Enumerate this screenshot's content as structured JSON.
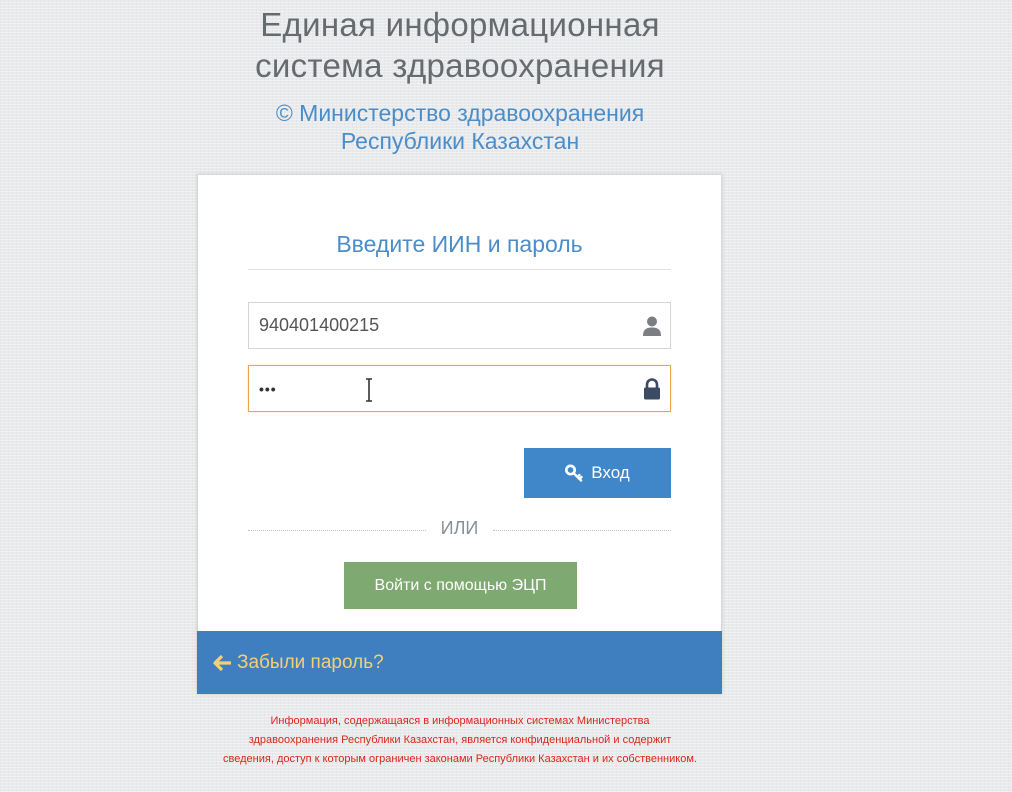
{
  "header": {
    "system_title_line1": "Единая информационная",
    "system_title_line2": "система здравоохранения",
    "ministry_line1": "© Министерство здравоохранения",
    "ministry_line2": "Республики Казахстан"
  },
  "login": {
    "heading": "Введите ИИН и пароль",
    "iin_value": "940401400215",
    "password_value": "•••",
    "login_button": "Вход",
    "or_text": "ИЛИ",
    "eds_button": "Войти с помощью ЭЦП",
    "forgot_password": "Забыли пароль?"
  },
  "icons": {
    "iin_field": "user-icon",
    "password_field": "lock-icon",
    "login_button": "key-icon",
    "forgot_password": "arrow-left-icon"
  },
  "disclaimer": {
    "line1": "Информация, содержащаяся в информационных системах Министерства",
    "line2": "здравоохранения Республики Казахстан, является конфиденциальной и содержит",
    "line3": "сведения, доступ к которым ограничен законами Республики Казахстан и их собственником."
  },
  "colors": {
    "accent_blue": "#3f87c9",
    "eds_green": "#7ea970",
    "forgot_link": "#f3cf79",
    "disclaimer_red": "#d9261c",
    "focus_border": "#f0a54a"
  }
}
